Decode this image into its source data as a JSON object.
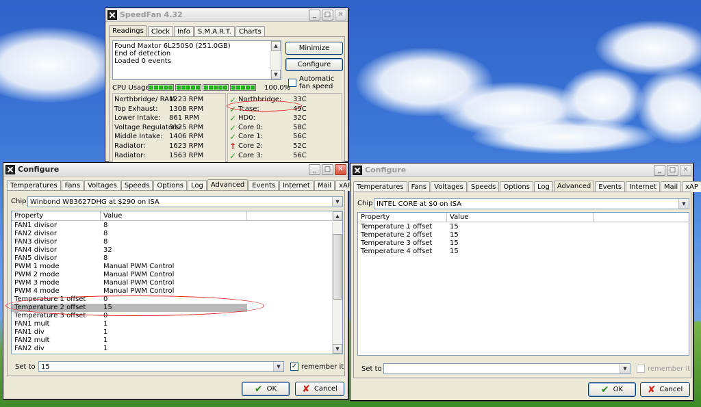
{
  "speedfan": {
    "title": "SpeedFan 4.32",
    "tabs": [
      "Readings",
      "Clock",
      "Info",
      "S.M.A.R.T.",
      "Charts"
    ],
    "log_lines": [
      "Found Maxtor 6L250S0 (251.0GB)",
      "End of detection",
      "Loaded 0 events"
    ],
    "minimize_label": "Minimize",
    "configure_label": "Configure",
    "auto_fan_label": "Automatic fan speed",
    "cpu_usage_label": "CPU Usage",
    "cpu_usage_value": "100.0%",
    "cpu_usage_percent": 100,
    "fans": [
      {
        "name": "Northbridge/ RAM:",
        "value": "1223 RPM"
      },
      {
        "name": "Top Exhaust:",
        "value": "1308 RPM"
      },
      {
        "name": "Lower Intake:",
        "value": "861 RPM"
      },
      {
        "name": "Voltage Regulators:",
        "value": "3125 RPM"
      },
      {
        "name": "Middle Intake:",
        "value": "1406 RPM"
      },
      {
        "name": "Radiator:",
        "value": "1623 RPM"
      },
      {
        "name": "Radiator:",
        "value": "1563 RPM"
      }
    ],
    "temps": [
      {
        "name": "Northbridge:",
        "value": "33C",
        "status": "ok"
      },
      {
        "name": "Tcase:",
        "value": "49C",
        "status": "ok"
      },
      {
        "name": "HD0:",
        "value": "32C",
        "status": "ok"
      },
      {
        "name": "Core 0:",
        "value": "58C",
        "status": "ok"
      },
      {
        "name": "Core 1:",
        "value": "56C",
        "status": "ok"
      },
      {
        "name": "Core 2:",
        "value": "52C",
        "status": "up"
      },
      {
        "name": "Core 3:",
        "value": "56C",
        "status": "ok"
      }
    ]
  },
  "configure_left": {
    "title": "Configure",
    "tabs": [
      "Temperatures",
      "Fans",
      "Voltages",
      "Speeds",
      "Options",
      "Log",
      "Advanced",
      "Events",
      "Internet",
      "Mail",
      "xAP"
    ],
    "chip_label": "Chip",
    "chip_value": "Winbond W83627DHG at $290 on ISA",
    "col_property": "Property",
    "col_value": "Value",
    "rows": [
      {
        "property": "FAN1 divisor",
        "value": "8"
      },
      {
        "property": "FAN2 divisor",
        "value": "8"
      },
      {
        "property": "FAN3 divisor",
        "value": "8"
      },
      {
        "property": "FAN4 divisor",
        "value": "32"
      },
      {
        "property": "FAN5 divisor",
        "value": "8"
      },
      {
        "property": "PWM 1 mode",
        "value": "Manual PWM Control"
      },
      {
        "property": "PWM 2 mode",
        "value": "Manual PWM Control"
      },
      {
        "property": "PWM 3 mode",
        "value": "Manual PWM Control"
      },
      {
        "property": "PWM 4 mode",
        "value": "Manual PWM Control"
      },
      {
        "property": "Temperature 1 offset",
        "value": "0"
      },
      {
        "property": "Temperature 2 offset",
        "value": "15"
      },
      {
        "property": "Temperature 3 offset",
        "value": "0"
      },
      {
        "property": "FAN1 mult",
        "value": "1"
      },
      {
        "property": "FAN1 div",
        "value": "1"
      },
      {
        "property": "FAN2 mult",
        "value": "1"
      },
      {
        "property": "FAN2 div",
        "value": "1"
      }
    ],
    "set_to_label": "Set to",
    "set_to_value": "15",
    "remember_label": "remember it",
    "ok_label": "OK",
    "cancel_label": "Cancel"
  },
  "configure_right": {
    "title": "Configure",
    "tabs": [
      "Temperatures",
      "Fans",
      "Voltages",
      "Speeds",
      "Options",
      "Log",
      "Advanced",
      "Events",
      "Internet",
      "Mail",
      "xAP"
    ],
    "chip_label": "Chip",
    "chip_value": "INTEL CORE at $0 on ISA",
    "col_property": "Property",
    "col_value": "Value",
    "rows": [
      {
        "property": "Temperature 1 offset",
        "value": "15"
      },
      {
        "property": "Temperature 2 offset",
        "value": "15"
      },
      {
        "property": "Temperature 3 offset",
        "value": "15"
      },
      {
        "property": "Temperature 4 offset",
        "value": "15"
      }
    ],
    "set_to_label": "Set to",
    "set_to_value": "",
    "remember_label": "remember it",
    "ok_label": "OK",
    "cancel_label": "Cancel"
  }
}
